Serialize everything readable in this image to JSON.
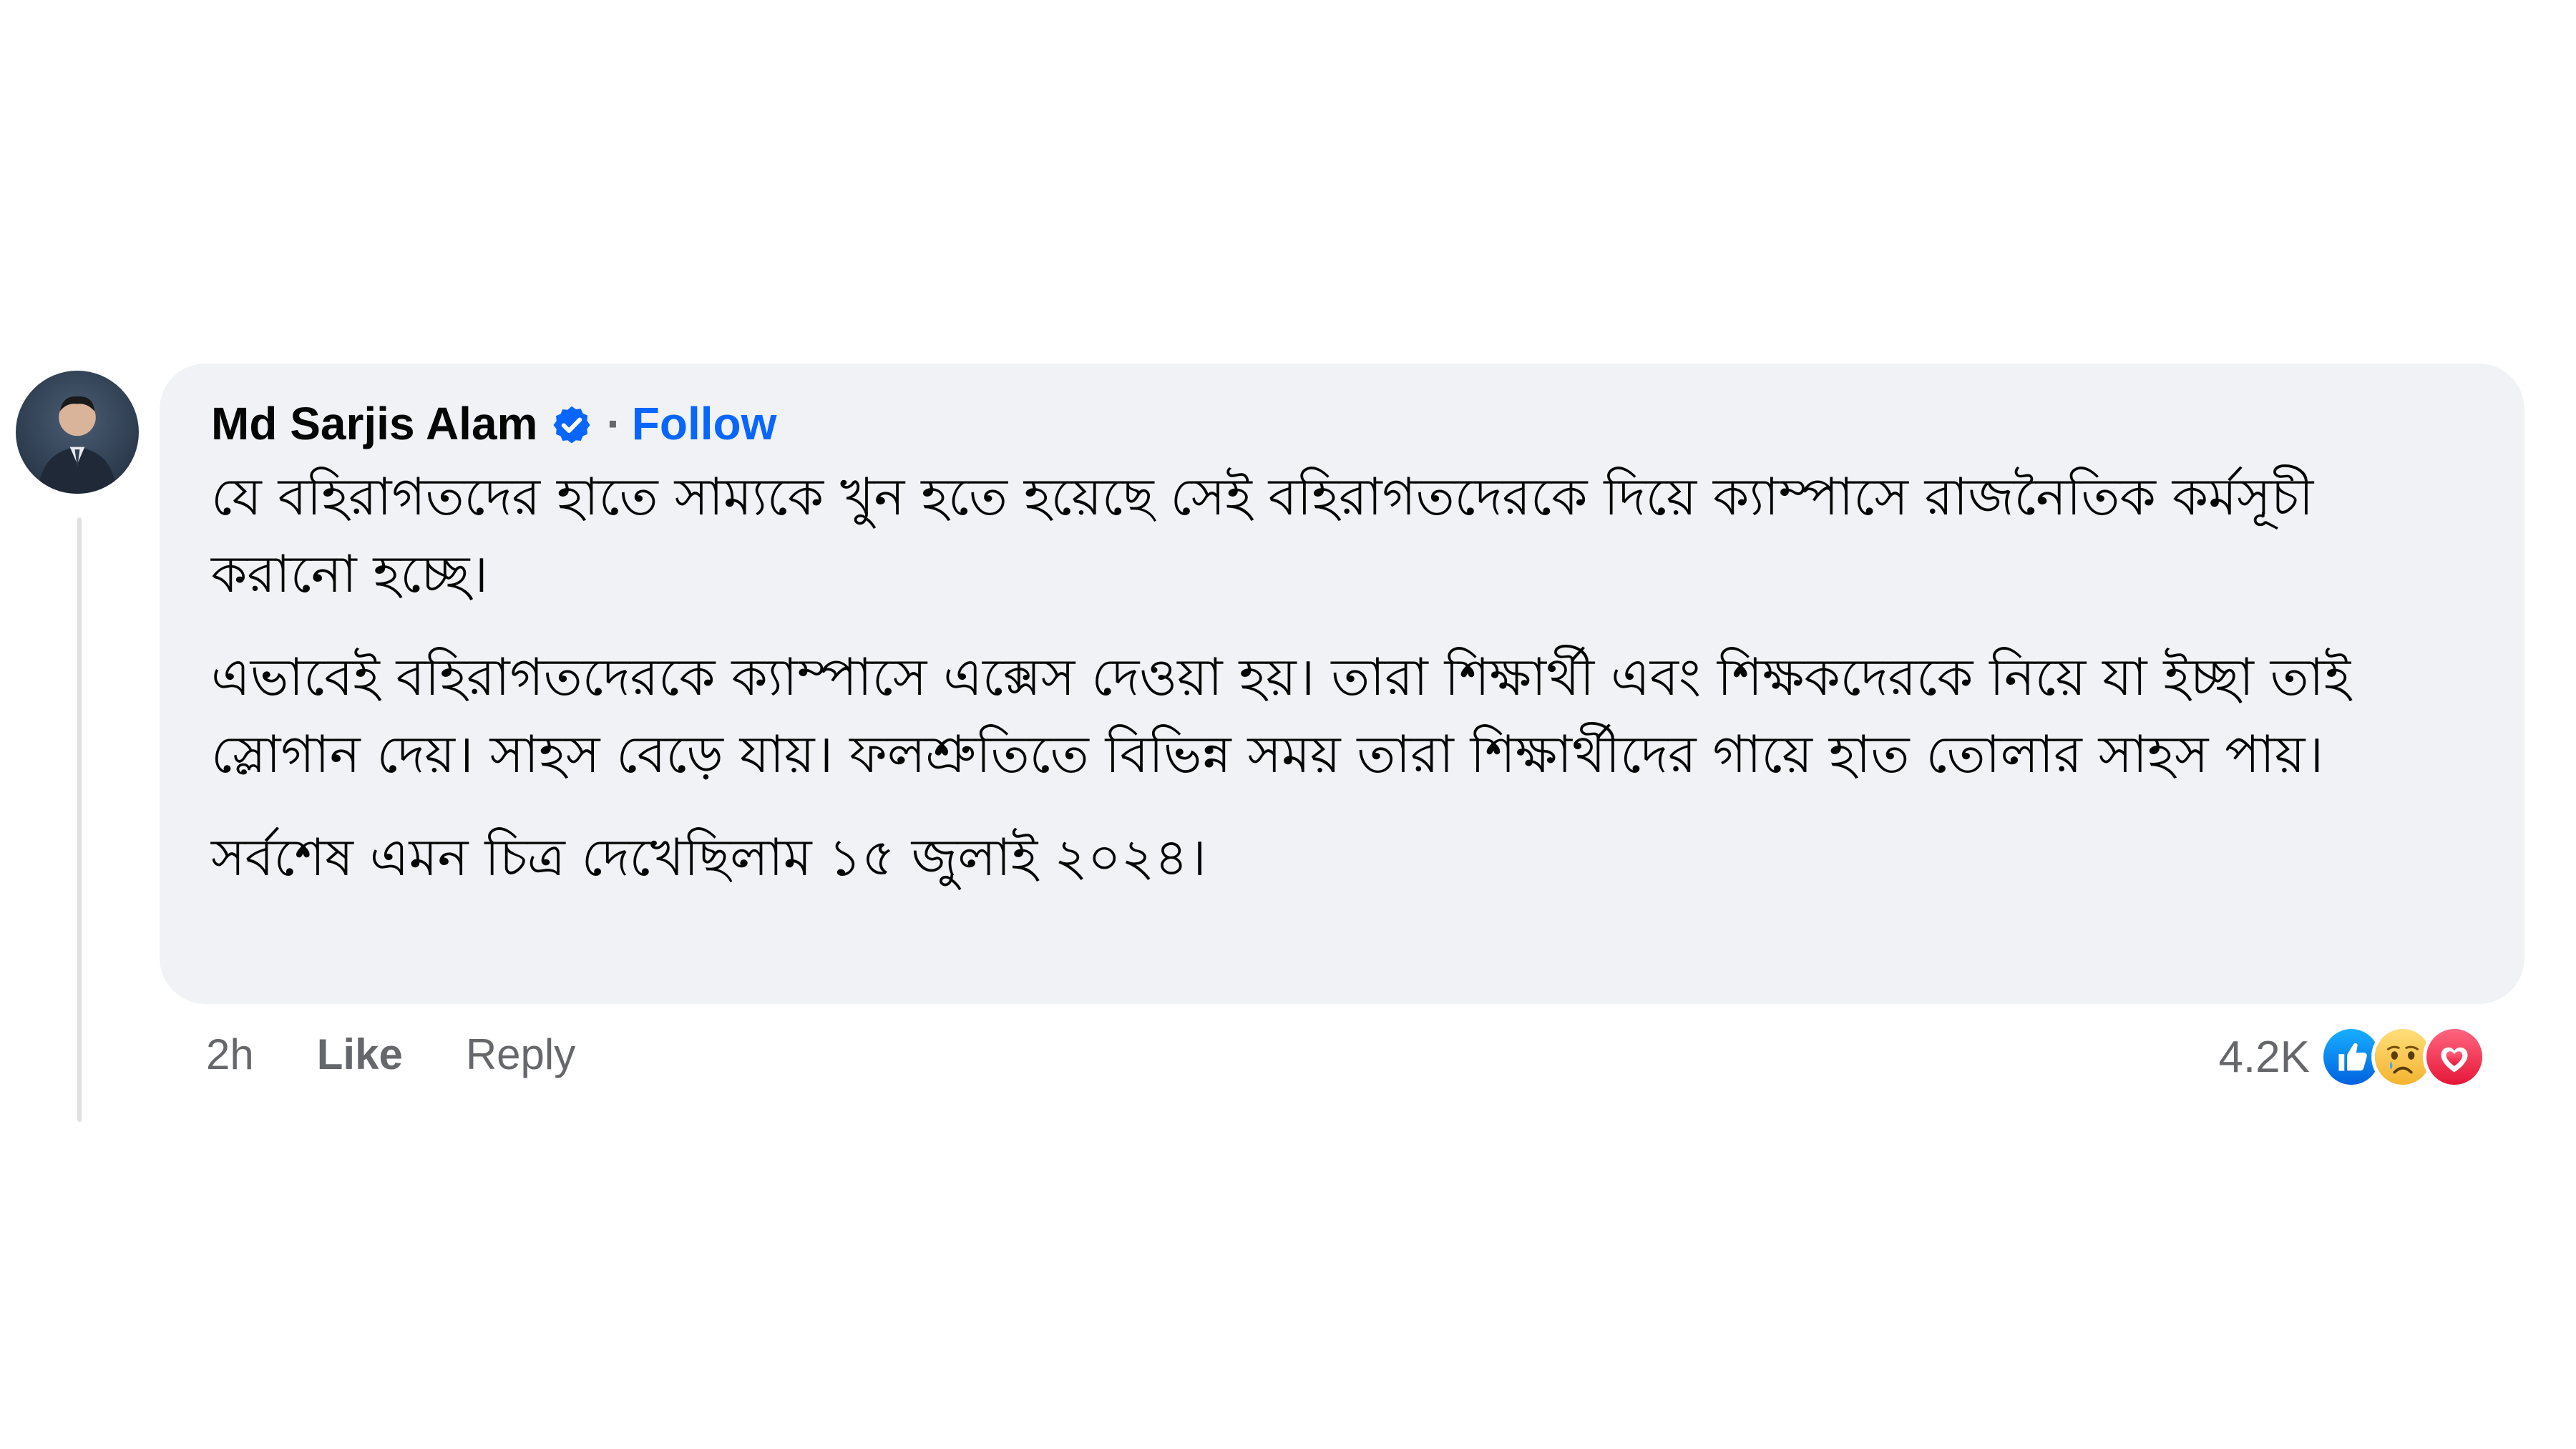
{
  "comment": {
    "author": "Md Sarjis Alam",
    "separator": "·",
    "follow_label": "Follow",
    "paragraphs": [
      "যে বহিরাগতদের হাতে সাম্যকে খুন হতে হয়েছে সেই বহিরাগতদেরকে দিয়ে ক্যাম্পাসে রাজনৈতিক কর্মসূচী করানো হচ্ছে।",
      "এভাবেই বহিরাগতদেরকে ক্যাম্পাসে এক্সেস দেওয়া হয়। তারা শিক্ষার্থী এবং শিক্ষকদেরকে নিয়ে যা ইচ্ছা তাই স্লোগান দেয়। সাহস বেড়ে যায়। ফলশ্রুতিতে বিভিন্ন সময় তারা শিক্ষার্থীদের গায়ে হাত তোলার সাহস পায়।",
      "সর্বশেষ এমন চিত্র দেখেছিলাম ১৫ জুলাই ২০২৪।"
    ],
    "time": "2h",
    "like_label": "Like",
    "reply_label": "Reply",
    "reaction_count": "4.2K",
    "reactions": [
      "like-icon",
      "sad-icon",
      "care-icon"
    ]
  },
  "colors": {
    "bubble": "#f0f2f5",
    "accent": "#0866ff",
    "meta": "#65676b"
  }
}
